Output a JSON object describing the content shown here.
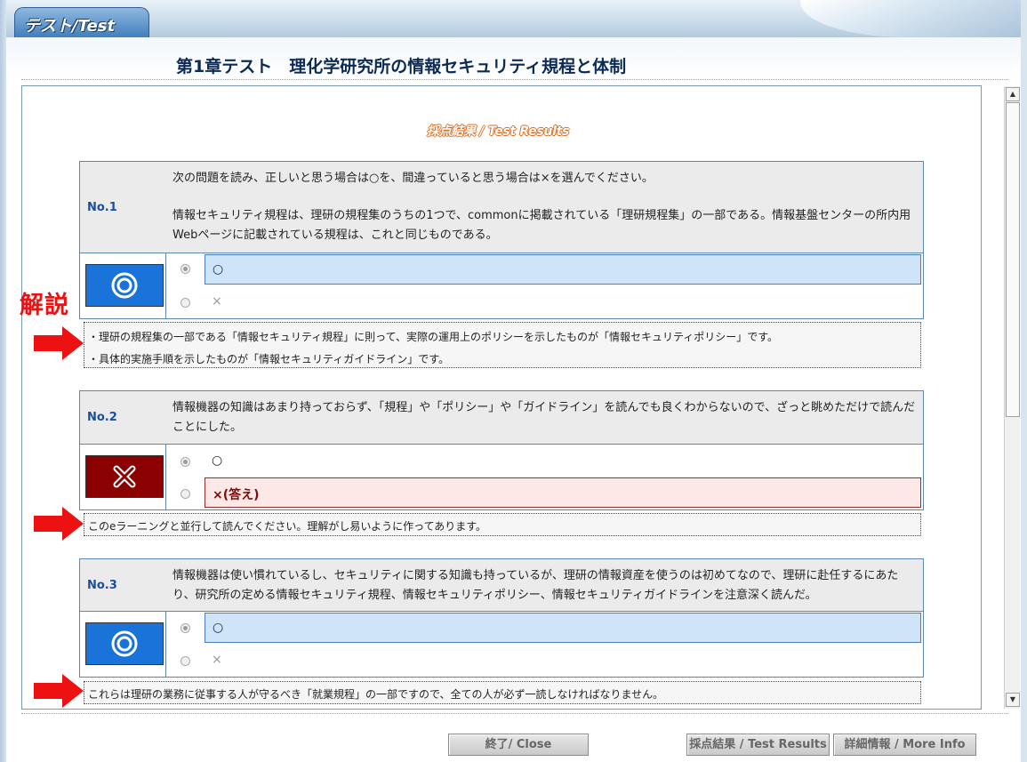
{
  "tab_label": "テスト/Test",
  "title": "第1章テスト　理化学研究所の情報セキュリティ規程と体制",
  "results_label": "採点結果 / Test Results",
  "kaisetsu_label": "解説",
  "questions": [
    {
      "no": "No.1",
      "text_1": "次の問題を読み、正しいと思う場合は○を、間違っていると思う場合は×を選んでください。",
      "text_2": "情報セキュリティ規程は、理研の規程集のうちの1つで、commonに掲載されている「理研規程集」の一部である。情報基盤センターの所内用Webページに記載されている規程は、これと同じものである。",
      "result_icon": "circle-correct-icon",
      "option_1": "○",
      "option_2": "×",
      "explanation_1": "・理研の規程集の一部である「情報セキュリティ規程」に則って、実際の運用上のポリシーを示したものが「情報セキュリティポリシー」です。",
      "explanation_2": "・具体的実施手順を示したものが「情報セキュリティガイドライン」です。"
    },
    {
      "no": "No.2",
      "text_1": "情報機器の知識はあまり持っておらず、「規程」や「ポリシー」や「ガイドライン」を読んでも良くわからないので、ざっと眺めただけで読んだことにした。",
      "result_icon": "cross-incorrect-icon",
      "option_1": "○",
      "option_2": "×(答え)",
      "explanation_1": "このeラーニングと並行して読んでください。理解がし易いように作ってあります。"
    },
    {
      "no": "No.3",
      "text_1": "情報機器は使い慣れているし、セキュリティに関する知識も持っているが、理研の情報資産を使うのは初めてなので、理研に赴任するにあたり、研究所の定める情報セキュリティ規程、情報セキュリティポリシー、情報セキュリティガイドラインを注意深く読んだ。",
      "result_icon": "circle-correct-icon",
      "option_1": "○",
      "option_2": "×",
      "explanation_1": "これらは理研の業務に従事する人が守るべき「就業規程」の一部ですので、全ての人が必ず一読しなければなりません。"
    }
  ],
  "buttons": {
    "close": "終了/ Close",
    "test_results": "採点結果 / Test Results",
    "more_info": "詳細情報 / More Info"
  },
  "colors": {
    "correct": "#1a73d9",
    "incorrect": "#8b0000",
    "arrow": "#ee1111",
    "title": "#0b2a55"
  }
}
